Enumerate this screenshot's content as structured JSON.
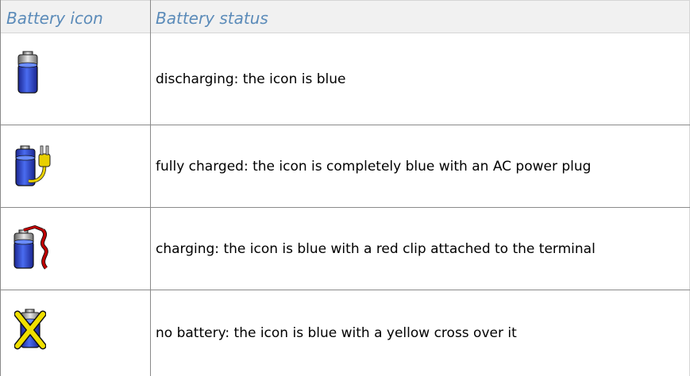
{
  "table": {
    "header": {
      "icon_column": "Battery icon",
      "status_column": "Battery status"
    },
    "rows": [
      {
        "icon": "battery-discharging-icon",
        "status": "discharging: the icon is blue"
      },
      {
        "icon": "battery-fully-charged-icon",
        "status": "fully charged: the icon is completely blue with an AC power plug"
      },
      {
        "icon": "battery-charging-icon",
        "status": "charging: the icon is blue with a red clip attached to the terminal"
      },
      {
        "icon": "no-battery-icon",
        "status": "no battery: the icon is blue with a yellow cross over it"
      }
    ]
  },
  "colors": {
    "header_text": "#5b8bb9",
    "header_bg": "#f1f1f1",
    "battery_blue": "#2f3fd0",
    "plug_yellow": "#e8d000",
    "clip_red": "#c00000",
    "cross_yellow": "#f0e000"
  }
}
